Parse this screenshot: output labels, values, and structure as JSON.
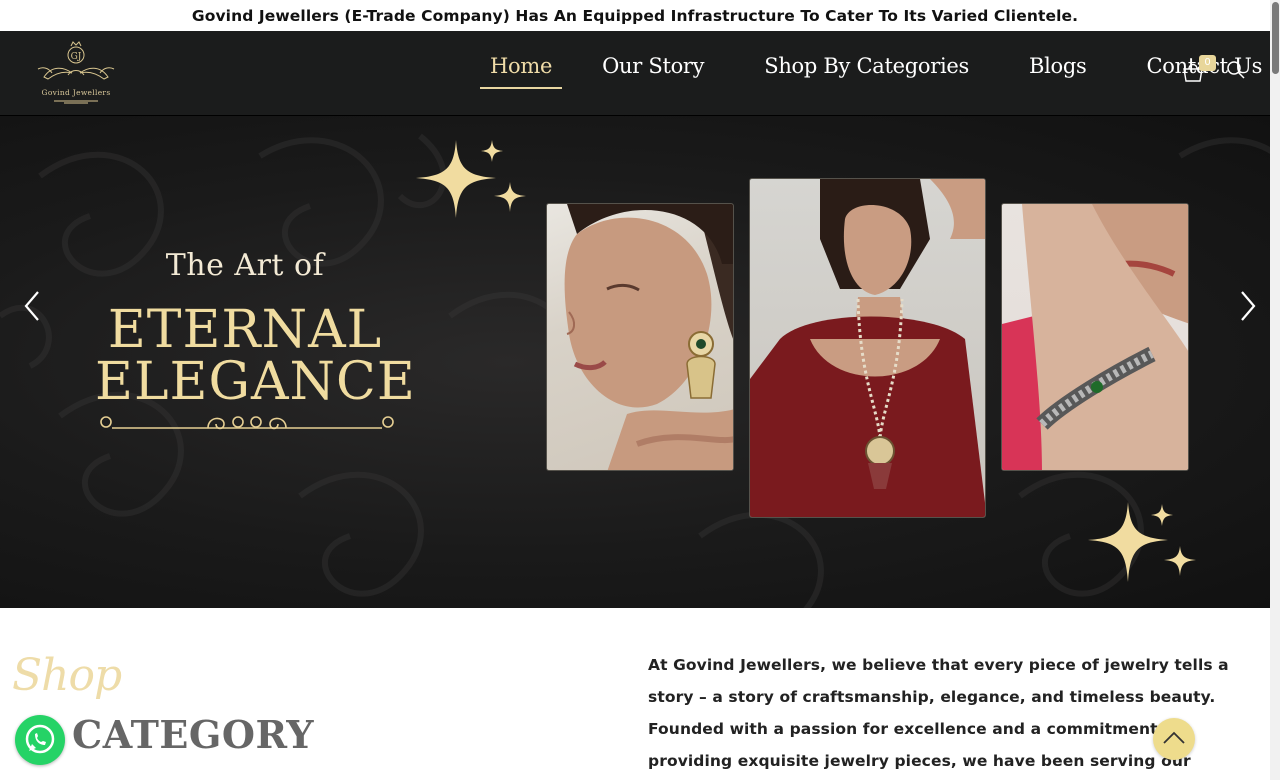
{
  "announcement": "Govind Jewellers (E-Trade Company) Has An Equipped Infrastructure To Cater To Its Varied Clientele.",
  "header": {
    "logo_monogram": "GJ",
    "logo_text": "Govind Jewellers",
    "nav": [
      {
        "label": "Home",
        "active": true
      },
      {
        "label": "Our Story",
        "active": false
      },
      {
        "label": "Shop By Categories",
        "active": false
      },
      {
        "label": "Blogs",
        "active": false
      },
      {
        "label": "Contact Us",
        "active": false
      }
    ],
    "cart_count": "0",
    "cart_icon": "shopping-bag-icon",
    "search_icon": "search-icon"
  },
  "hero": {
    "subtitle": "The Art of",
    "title_line1": "ETERNAL",
    "title_line2": "ELEGANCE",
    "prev_icon": "chevron-left-icon",
    "next_icon": "chevron-right-icon"
  },
  "shop_section": {
    "script_label": "Shop",
    "heading": "CATEGORY"
  },
  "about": {
    "text": "At Govind Jewellers, we believe that every piece of jewelry tells a story – a story of craftsmanship, elegance, and timeless beauty. Founded with a passion for excellence and a commitment to providing exquisite jewelry pieces, we have been serving our customers with unparalleled"
  },
  "floating": {
    "whatsapp_icon": "whatsapp-icon",
    "scroll_top_icon": "chevron-up-icon"
  },
  "colors": {
    "header_bg": "#1b1c1c",
    "gold_accent": "#f0dca0",
    "whatsapp_green": "#25d366",
    "scroll_top_bg": "#eedc8c"
  }
}
